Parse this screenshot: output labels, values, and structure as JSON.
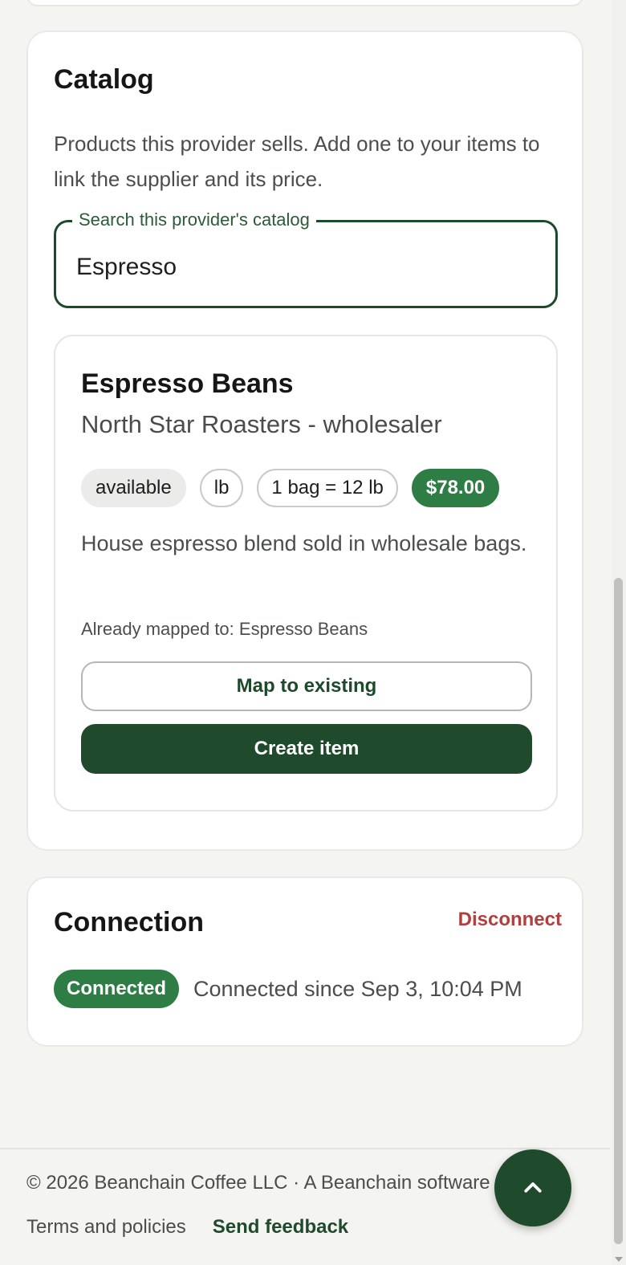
{
  "catalog": {
    "title": "Catalog",
    "description": "Products this provider sells. Add one to your items to link the supplier and its price.",
    "search": {
      "label": "Search this provider's catalog",
      "value": "Espresso"
    },
    "results": [
      {
        "name": "Espresso Beans",
        "supplier": "North Star Roasters - wholesaler",
        "availability": "available",
        "unit": "lb",
        "pack": "1 bag = 12 lb",
        "price": "$78.00",
        "description": "House espresso blend sold in wholesale bags.",
        "mapped_note": "Already mapped to: Espresso Beans",
        "map_button": "Map to existing",
        "create_button": "Create item"
      }
    ]
  },
  "connection": {
    "title": "Connection",
    "disconnect_label": "Disconnect",
    "status_badge": "Connected",
    "status_text": "Connected since Sep 3, 10:04 PM"
  },
  "footer": {
    "copyright": "© 2026 Beanchain Coffee LLC · A Beanchain software",
    "links": [
      "Terms and policies",
      "Send feedback"
    ]
  },
  "icons": {
    "fab": "chevron-up-icon"
  },
  "colors": {
    "primary": "#1f4a2c",
    "success": "#2e7d45",
    "danger": "#b04040"
  }
}
